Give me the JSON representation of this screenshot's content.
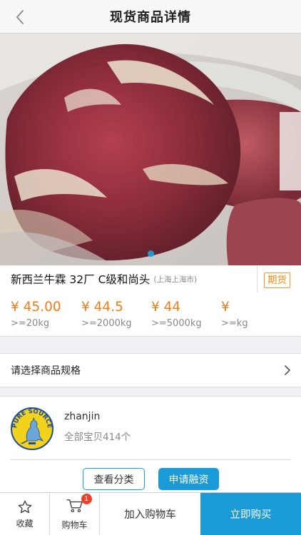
{
  "nav": {
    "title": "现货商品详情",
    "back_icon": "chevron-left-icon"
  },
  "hero": {
    "image": "raw beef cut photo",
    "page_count": 1,
    "active_page": 1,
    "indicator_color": "#1a9bd7"
  },
  "product": {
    "name": "新西兰牛霖 32厂 C级和尚头",
    "location": "(上海上海市)",
    "badge": "期货",
    "price_tiers": [
      {
        "price": "¥ 45.00",
        "qty": ">=20kg"
      },
      {
        "price": "¥ 44.5",
        "qty": ">=2000kg"
      },
      {
        "price": "¥ 44",
        "qty": ">=5000kg"
      },
      {
        "price": "¥",
        "qty": ">=kg"
      }
    ]
  },
  "spec": {
    "label": "请选择商品规格",
    "arrow_icon": "chevron-right-icon"
  },
  "store": {
    "logo_alt": "PURE SOURCE kangaroo logo",
    "logo_text": "PURE SOURCE",
    "name": "zhanjin",
    "count": "全部宝贝414个",
    "view_category": "查看分类",
    "apply_finance": "申请融资"
  },
  "tabbar": {
    "favorite": "收藏",
    "cart": "购物车",
    "cart_count": "1",
    "add_to_cart": "加入购物车",
    "buy_now": "立即购买"
  },
  "colors": {
    "accent": "#1a9bd7",
    "price": "#f07c16",
    "badge": "#f08a14",
    "alert": "#e8402c"
  }
}
